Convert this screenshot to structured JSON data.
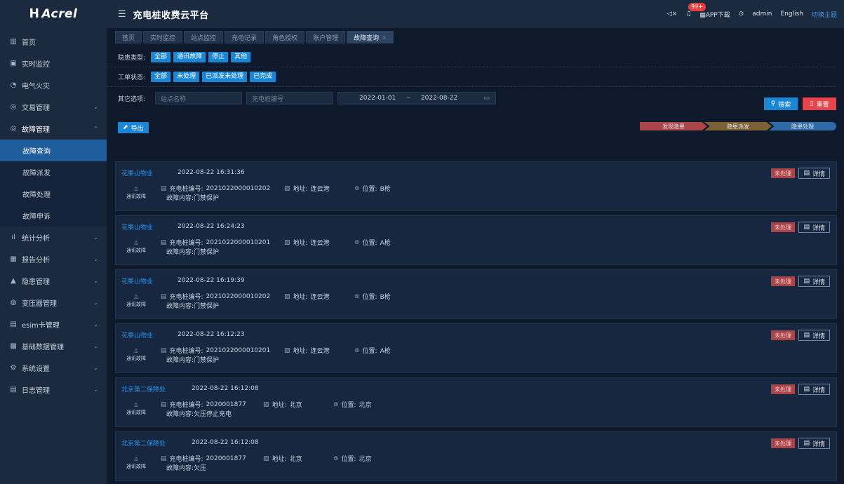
{
  "brand": {
    "logo_text": "Acrel"
  },
  "header": {
    "title": "充电桩收费云平台",
    "badge": "99+",
    "app_download": "APP下载",
    "user": "admin",
    "lang": "English",
    "switch_theme": "切换主题"
  },
  "sidebar": {
    "items": [
      {
        "label": "首页",
        "icon": "home-icon",
        "glyph": "▥",
        "chevron": ""
      },
      {
        "label": "实时监控",
        "icon": "monitor-icon",
        "glyph": "▣",
        "chevron": ""
      },
      {
        "label": "电气火灾",
        "icon": "fire-icon",
        "glyph": "◔",
        "chevron": ""
      },
      {
        "label": "交易管理",
        "icon": "trade-icon",
        "glyph": "◎",
        "chevron": "⌄"
      },
      {
        "label": "故障管理",
        "icon": "fault-icon",
        "glyph": "◎",
        "chevron": "⌃"
      }
    ],
    "sub_items": [
      {
        "label": "故障查询",
        "active": true
      },
      {
        "label": "故障派发",
        "active": false
      },
      {
        "label": "故障处理",
        "active": false
      },
      {
        "label": "故障申诉",
        "active": false
      }
    ],
    "items_after": [
      {
        "label": "统计分析",
        "icon": "stats-icon",
        "glyph": "ıl",
        "chevron": "⌄"
      },
      {
        "label": "报告分析",
        "icon": "report-icon",
        "glyph": "▦",
        "chevron": "⌄"
      },
      {
        "label": "隐患管理",
        "icon": "warning-icon",
        "glyph": "▲",
        "chevron": "⌄"
      },
      {
        "label": "变压器管理",
        "icon": "transformer-icon",
        "glyph": "◍",
        "chevron": "⌄"
      },
      {
        "label": "esim卡管理",
        "icon": "sim-icon",
        "glyph": "▤",
        "chevron": "⌄"
      },
      {
        "label": "基础数据管理",
        "icon": "data-icon",
        "glyph": "▩",
        "chevron": "⌄"
      },
      {
        "label": "系统设置",
        "icon": "settings-icon",
        "glyph": "⚙",
        "chevron": "⌄"
      },
      {
        "label": "日志管理",
        "icon": "log-icon",
        "glyph": "▤",
        "chevron": "⌄"
      }
    ]
  },
  "tabs": [
    {
      "label": "首页",
      "active": false
    },
    {
      "label": "实时监控",
      "active": false
    },
    {
      "label": "站点监控",
      "active": false
    },
    {
      "label": "充电记录",
      "active": false
    },
    {
      "label": "角色授权",
      "active": false
    },
    {
      "label": "账户管理",
      "active": false
    },
    {
      "label": "故障查询",
      "active": true
    }
  ],
  "filters": {
    "type_label": "隐患类型:",
    "type_options": [
      "全部",
      "通讯故障",
      "停止",
      "其他"
    ],
    "status_label": "工单状态:",
    "status_options": [
      "全部",
      "未处理",
      "已派发未处理",
      "已完成"
    ],
    "other_label": "其它选项:",
    "site_placeholder": "站点名称",
    "pile_placeholder": "充电桩编号",
    "date_start": "2022-01-01",
    "date_sep": "~",
    "date_end": "2022-08-22",
    "search_label": "搜索",
    "reset_label": "重置"
  },
  "toolbar": {
    "export_label": "导出",
    "steps": [
      "发现隐患",
      "隐患派发",
      "隐患处理"
    ]
  },
  "labels": {
    "pile_no": "充电桩编号:",
    "address": "地址:",
    "position": "位置:",
    "content": "故障内容:",
    "detail": "详情"
  },
  "records": [
    {
      "site": "花果山物业",
      "time": "2022-08-22 16:31:36",
      "fault_type": "通讯故障",
      "pile_no": "2021022000010202",
      "address": "连云港",
      "position": "B枪",
      "content": "门禁保护",
      "status": "未处理"
    },
    {
      "site": "花果山物业",
      "time": "2022-08-22 16:24:23",
      "fault_type": "通讯故障",
      "pile_no": "2021022000010201",
      "address": "连云港",
      "position": "A枪",
      "content": "门禁保护",
      "status": "未处理"
    },
    {
      "site": "花果山物业",
      "time": "2022-08-22 16:19:39",
      "fault_type": "通讯故障",
      "pile_no": "2021022000010202",
      "address": "连云港",
      "position": "B枪",
      "content": "门禁保护",
      "status": "未处理"
    },
    {
      "site": "花果山物业",
      "time": "2022-08-22 16:12:23",
      "fault_type": "通讯故障",
      "pile_no": "2021022000010201",
      "address": "连云港",
      "position": "A枪",
      "content": "门禁保护",
      "status": "未处理"
    },
    {
      "site": "北京第二保障处",
      "time": "2022-08-22 16:12:08",
      "fault_type": "通讯故障",
      "pile_no": "2020001877",
      "address": "北京",
      "position": "北京",
      "content": "欠压停止充电",
      "status": "未处理"
    },
    {
      "site": "北京第二保障处",
      "time": "2022-08-22 16:12:08",
      "fault_type": "通讯故障",
      "pile_no": "2020001877",
      "address": "北京",
      "position": "北京",
      "content": "欠压",
      "status": "未处理"
    }
  ]
}
